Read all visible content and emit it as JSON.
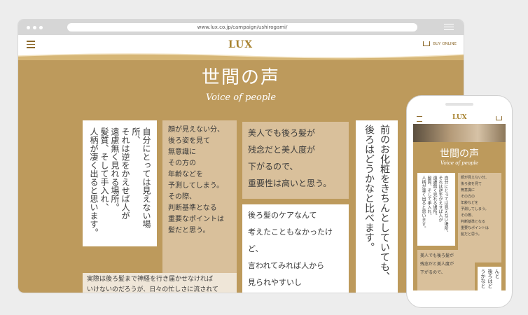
{
  "browser": {
    "url": "www.lux.co.jp/campaign/ushirogami/"
  },
  "site": {
    "logo": "LUX",
    "buy_label": "BUY ONLINE"
  },
  "hero": {
    "title": "世間の声",
    "subtitle": "Voice  of  people"
  },
  "cards": {
    "c1": "自分にとっては見えない場所、\nそれは逆をかえせば人が\n遠慮無く見れる場所。\n髪質、そして手入れ、\n人柄が凄く出ると思います。",
    "c2": "顔が見えない分、\n後ろ姿を見て\n無意識に\nその方の\n年齢などを\n予測してしまう。\nその際、\n判断基準となる\n重要なポイントは\n髪だと思う。",
    "c3": "美人でも後ろ髪が\n残念だと美人度が\n下がるので、\n重要性は高いと思う。",
    "c4": "後ろ髪のケアなんて\n考えたこともなかったけど、\n言われてみれば人から\n見られやすいし\n大事だなと思った。",
    "c5": "前のお化粧をきちんとしていても、\n後ろはどうかなと比べます。",
    "c6": "実際は後ろ髪まで神経を行き届かせなければ\nいけないのだろうが、日々の忙しさに流されて\nケアできていない。"
  },
  "phone": {
    "logo": "LUX",
    "title": "世間の声",
    "subtitle": "Voice of people",
    "c1": "自分にとっては見えない場所、\nそれは逆をかえせば人が\n遠慮無く見れる場所。\n髪質、そして手入れ、\n人柄が凄く出ると思います。",
    "c2": "顔が見えない分、\n後ろ姿を見て\n無意識に\nその方の\n年齢などを\n予測してしまう。\nその際、\n判断基準となる\n重要なポイントは\n髪だと思う。",
    "c3": "美人でも後ろ髪が\n残念だと美人度が\n下がるので、",
    "c4": "前のお化粧をきちんと\n後ろはどうかなと"
  }
}
